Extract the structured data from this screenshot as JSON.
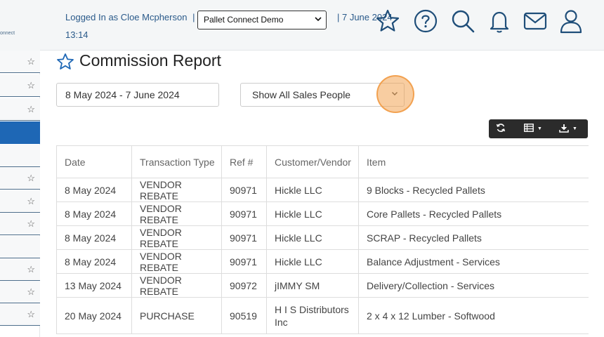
{
  "header": {
    "logo_text": "onnect",
    "logged_in": "Logged In as Cloe Mcpherson",
    "separator": "|",
    "company": "Pallet Connect Demo",
    "date": "| 7 June 2024",
    "time": "13:14",
    "icons": [
      "star-icon",
      "help-icon",
      "search-icon",
      "bell-icon",
      "mail-icon",
      "user-icon"
    ]
  },
  "sidebar": {
    "items": [
      {
        "star": "☆"
      },
      {
        "star": "☆"
      },
      {
        "star": "☆"
      },
      {
        "star": ""
      },
      {
        "star": ""
      },
      {
        "star": "☆"
      },
      {
        "star": "☆"
      },
      {
        "star": "☆"
      },
      {
        "star": ""
      },
      {
        "star": "☆"
      },
      {
        "star": "☆"
      },
      {
        "star": "☆"
      }
    ],
    "active_color": "#1e67b5"
  },
  "page": {
    "title": "Commission Report"
  },
  "filters": {
    "date_range": "8 May 2024 - 7 June 2024",
    "sales_people": "Show All Sales People"
  },
  "toolbar": {
    "refresh_icon": "refresh-icon",
    "columns_icon": "table-icon",
    "download_icon": "download-icon"
  },
  "table": {
    "headers": [
      "Date",
      "Transaction Type",
      "Ref #",
      "Customer/Vendor",
      "Item"
    ],
    "rows": [
      [
        "8 May 2024",
        "VENDOR REBATE",
        "90971",
        "Hickle LLC",
        "9 Blocks - Recycled Pallets"
      ],
      [
        "8 May 2024",
        "VENDOR REBATE",
        "90971",
        "Hickle LLC",
        "Core Pallets - Recycled Pallets"
      ],
      [
        "8 May 2024",
        "VENDOR REBATE",
        "90971",
        "Hickle LLC",
        "SCRAP - Recycled Pallets"
      ],
      [
        "8 May 2024",
        "VENDOR REBATE",
        "90971",
        "Hickle LLC",
        "Balance Adjustment - Services"
      ],
      [
        "13 May 2024",
        "VENDOR REBATE",
        "90972",
        "jIMMY SM",
        "Delivery/Collection - Services"
      ],
      [
        "20 May 2024",
        "PURCHASE",
        "90519",
        "H I S Distributors Inc",
        "2 x 4 x 12 Lumber - Softwood"
      ]
    ]
  },
  "colors": {
    "link_blue": "#2a5a8a",
    "active_nav": "#1e67b5",
    "toolbar_bg": "#2b2b2b"
  }
}
